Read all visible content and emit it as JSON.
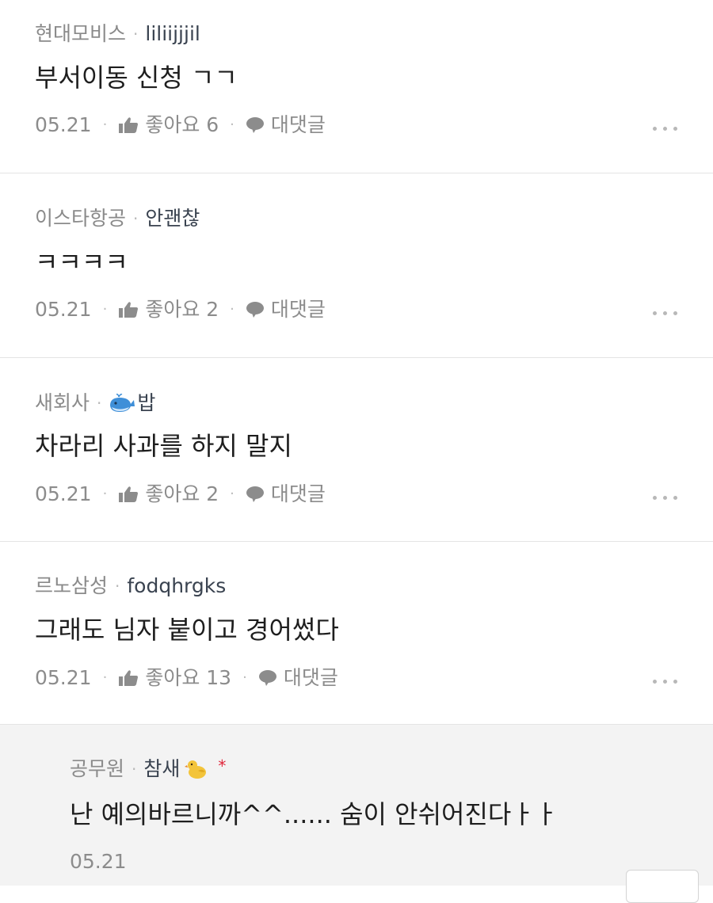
{
  "comments": [
    {
      "company": "현대모비스",
      "nickname": "liliijjjil",
      "text": "부서이동 신청 ㄱㄱ",
      "date": "05.21",
      "like_label": "좋아요 6",
      "reply_label": "대댓글"
    },
    {
      "company": "이스타항공",
      "nickname": "안괜찮",
      "text": "ㅋㅋㅋㅋ",
      "date": "05.21",
      "like_label": "좋아요 2",
      "reply_label": "대댓글"
    },
    {
      "company": "새회사",
      "nickname": "밥",
      "text": "차라리 사과를 하지 말지",
      "date": "05.21",
      "like_label": "좋아요 2",
      "reply_label": "대댓글"
    },
    {
      "company": "르노삼성",
      "nickname": "fodqhrgks",
      "text": "그래도 님자 붙이고 경어썼다",
      "date": "05.21",
      "like_label": "좋아요 13",
      "reply_label": "대댓글"
    }
  ],
  "reply": {
    "company": "공무원",
    "nickname": "참새",
    "author_mark": "*",
    "text": "난 예의바르니까^^...... 숨이 안쉬어진다ㅏㅏ",
    "date": "05.21"
  },
  "icons": {
    "like": "thumbs-up-icon",
    "reply": "speech-bubble-icon",
    "more": "more-dots-icon",
    "whale": "whale-icon",
    "chick": "chick-icon"
  },
  "colors": {
    "meta_gray": "#8a8a8a",
    "nickname": "#3a4350",
    "author_star": "#e0253a",
    "reply_bg": "#f3f3f3"
  }
}
